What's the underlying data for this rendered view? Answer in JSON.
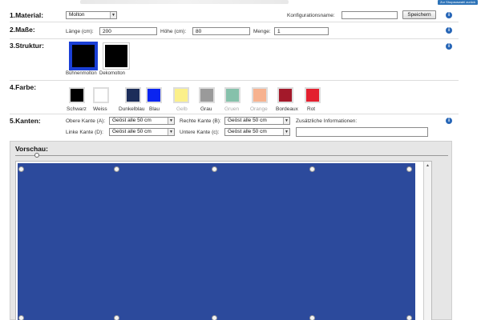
{
  "top": {
    "shop_button": "Zur Shopauswahl zurück"
  },
  "material": {
    "title": "1.Material:",
    "selected": "Molton",
    "config_label": "Konfigurationsname:",
    "config_value": "",
    "save_label": "Speichern"
  },
  "masse": {
    "title": "2.Maße:",
    "length_label": "Länge (cm):",
    "length_value": "200",
    "height_label": "Höhe (cm):",
    "height_value": "80",
    "qty_label": "Menge:",
    "qty_value": "1"
  },
  "struktur": {
    "title": "3.Struktur:",
    "items": [
      {
        "label": "Bühnenmolton",
        "selected": true
      },
      {
        "label": "Dekomolton",
        "selected": false
      }
    ]
  },
  "farbe": {
    "title": "4.Farbe:",
    "items": [
      {
        "label": "Schwarz",
        "color": "#000000",
        "label_color": "#333333"
      },
      {
        "label": "Weiss",
        "color": "#ffffff",
        "label_color": "#333333"
      },
      {
        "label": "Dunkelblau",
        "color": "#1c2d5a",
        "label_color": "#333333"
      },
      {
        "label": "Blau",
        "color": "#0a24f0",
        "label_color": "#333333"
      },
      {
        "label": "Gelb",
        "color": "#fbf08a",
        "label_color": "#a8a8a8"
      },
      {
        "label": "Grau",
        "color": "#9a9a9a",
        "label_color": "#333333"
      },
      {
        "label": "Gruen",
        "color": "#86c1ab",
        "label_color": "#a8a8a8"
      },
      {
        "label": "Orange",
        "color": "#f7b28f",
        "label_color": "#a8a8a8"
      },
      {
        "label": "Bordeaux",
        "color": "#a3192a",
        "label_color": "#333333"
      },
      {
        "label": "Rot",
        "color": "#e3202f",
        "label_color": "#333333"
      }
    ]
  },
  "kanten": {
    "title": "5.Kanten:",
    "top_label": "Obere Kante (A):",
    "top_value": "Geöst alle 50 cm",
    "right_label": "Rechte Kante (B):",
    "right_value": "Geöst alle 50 cm",
    "left_label": "Linke Kante (D):",
    "left_value": "Geöst alle 50 cm",
    "bottom_label": "Untere Kante (c):",
    "bottom_value": "Geöst alle 50 cm",
    "extra_label": "Zusätzliche Informationen:",
    "extra_value": ""
  },
  "vorschau": {
    "title": "Vorschau:",
    "curtain_color": "#2c4a9c"
  }
}
